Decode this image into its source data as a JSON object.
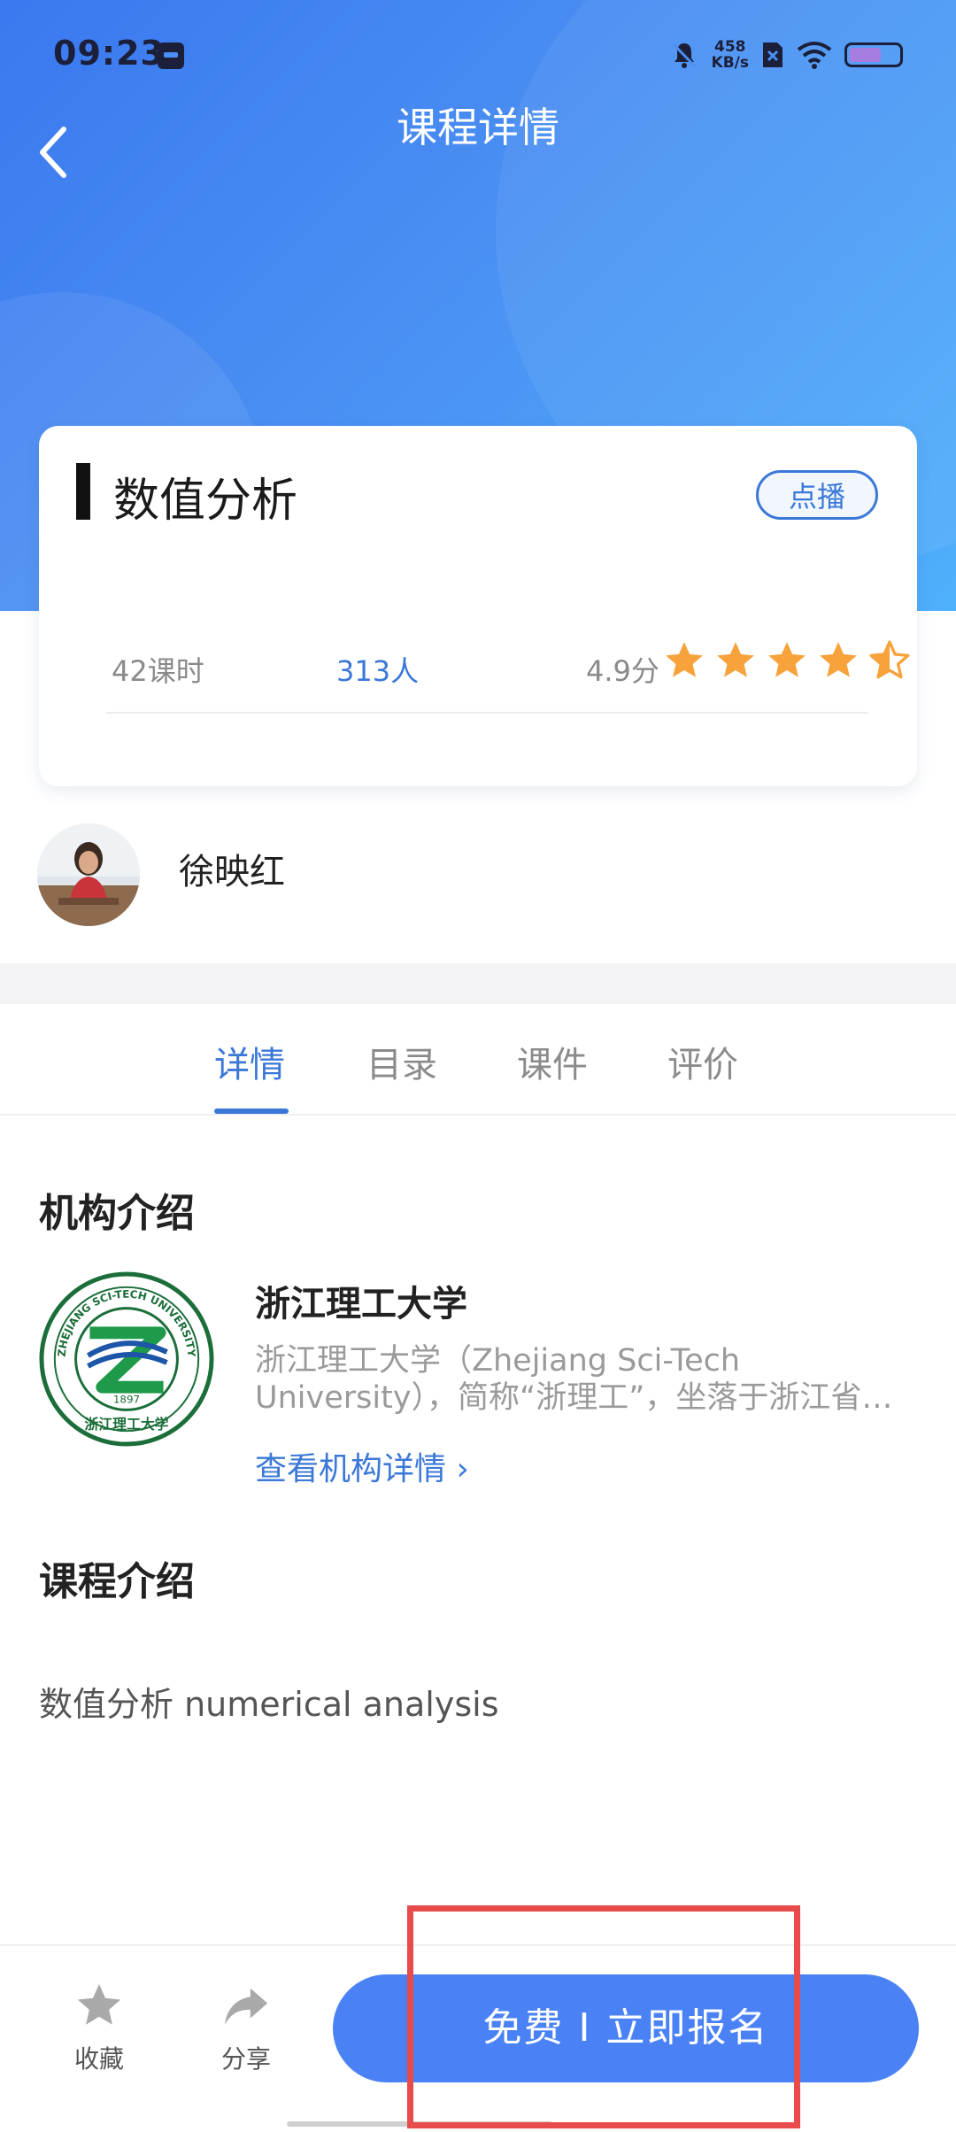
{
  "status_bar": {
    "time": "09:23",
    "net_speed_value": "458",
    "net_speed_unit": "KB/s"
  },
  "header": {
    "title": "课程详情"
  },
  "course": {
    "title": "数值分析",
    "type_badge": "点播",
    "hours": "42课时",
    "students": "313人",
    "rating": "4.9分",
    "stars": 4.5
  },
  "teacher": {
    "name": "徐映红"
  },
  "tabs": [
    {
      "label": "详情",
      "active": true
    },
    {
      "label": "目录",
      "active": false
    },
    {
      "label": "课件",
      "active": false
    },
    {
      "label": "评价",
      "active": false
    }
  ],
  "institution": {
    "section_title": "机构介绍",
    "name": "浙江理工大学",
    "description": "浙江理工大学（Zhejiang Sci-Tech University），简称“浙理工”，坐落于浙江省…",
    "link_label": "查看机构详情 ›",
    "logo_text_top": "ZHEJIANG SCI-TECH UNIVERSITY",
    "logo_year": "1897",
    "logo_text_bottom": "浙江理工大学"
  },
  "course_intro": {
    "section_title": "课程介绍",
    "text": "数值分析 numerical analysis"
  },
  "bottom_bar": {
    "favorite_label": "收藏",
    "share_label": "分享",
    "enroll_label": "免费 I 立即报名"
  },
  "colors": {
    "accent": "#3b78d8",
    "button": "#4a82f6",
    "star": "#f7a23a",
    "highlight": "#e84b4b"
  }
}
